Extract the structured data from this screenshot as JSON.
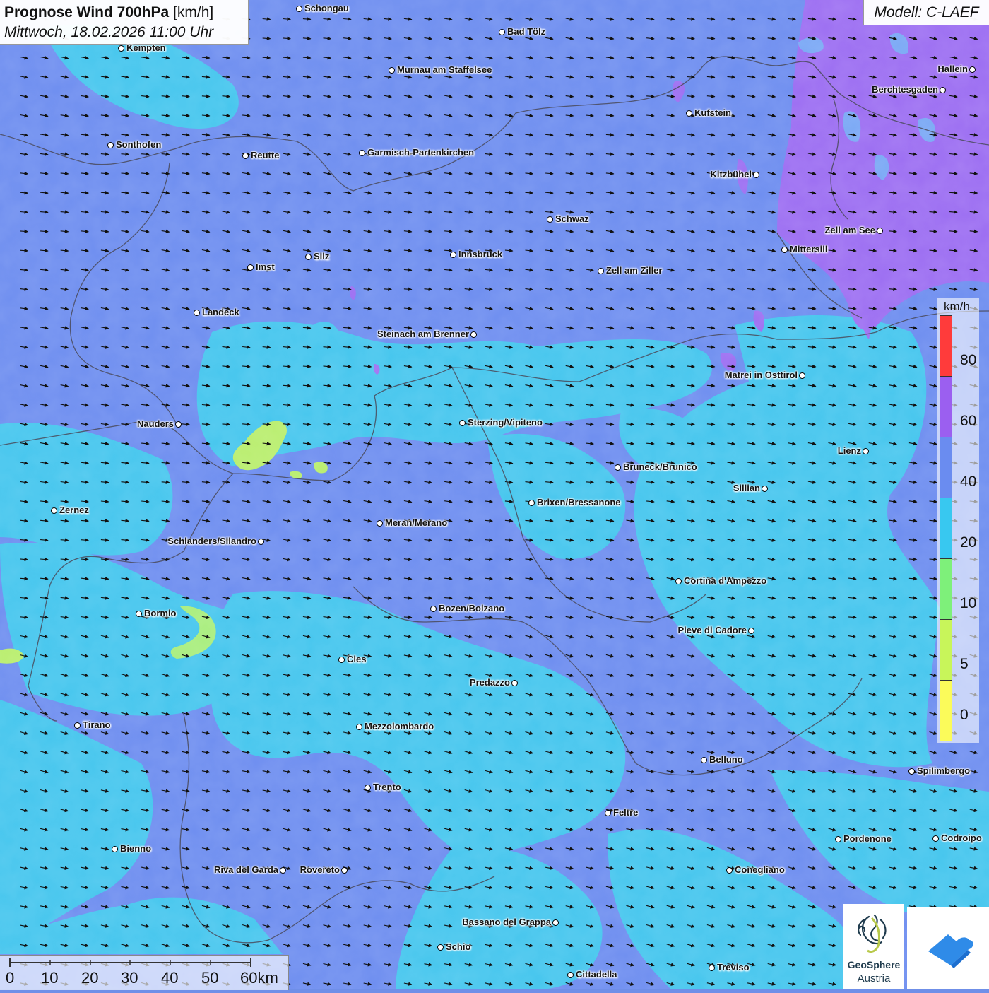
{
  "title": {
    "bold": "Prognose Wind 700hPa",
    "unit": "[km/h]",
    "datetime": "Mittwoch, 18.02.2026 11:00 Uhr"
  },
  "model": "Modell: C-LAEF",
  "legend": {
    "unit": "km/h",
    "ticks": [
      "80",
      "60",
      "40",
      "20",
      "10",
      "5",
      "0"
    ],
    "colors": [
      "#ff3b3b",
      "#9b5ff0",
      "#6a8cf0",
      "#38c8f0",
      "#7ef07a",
      "#c8f55a",
      "#fbfb5a"
    ]
  },
  "wind": {
    "direction": "west-northwest flow",
    "range_kmh": "20-80"
  },
  "cities": [
    {
      "name": "Schongau"
    },
    {
      "name": "Bad Tölz"
    },
    {
      "name": "Kempten"
    },
    {
      "name": "Murnau am Staffelsee"
    },
    {
      "name": "Hallein"
    },
    {
      "name": "Berchtesgaden"
    },
    {
      "name": "Kufstein"
    },
    {
      "name": "Sonthofen"
    },
    {
      "name": "Reutte"
    },
    {
      "name": "Garmisch-Partenkirchen"
    },
    {
      "name": "Kitzbühel"
    },
    {
      "name": "Schwaz"
    },
    {
      "name": "Zell am See"
    },
    {
      "name": "Mittersill"
    },
    {
      "name": "Innsbruck"
    },
    {
      "name": "Silz"
    },
    {
      "name": "Imst"
    },
    {
      "name": "Zell am Ziller"
    },
    {
      "name": "Landeck"
    },
    {
      "name": "Steinach am Brenner"
    },
    {
      "name": "Matrei in Osttirol"
    },
    {
      "name": "Nauders"
    },
    {
      "name": "Sterzing/Vipiteno"
    },
    {
      "name": "Lienz"
    },
    {
      "name": "Bruneck/Brunico"
    },
    {
      "name": "Sillian"
    },
    {
      "name": "Brixen/Bressanone"
    },
    {
      "name": "Zernez"
    },
    {
      "name": "Meran/Merano"
    },
    {
      "name": "Schlanders/Silandro"
    },
    {
      "name": "Cortina d'Ampezzo"
    },
    {
      "name": "Bozen/Bolzano"
    },
    {
      "name": "Bormio"
    },
    {
      "name": "Pieve di Cadore"
    },
    {
      "name": "Cles"
    },
    {
      "name": "Predazzo"
    },
    {
      "name": "Tirano"
    },
    {
      "name": "Mezzolombardo"
    },
    {
      "name": "Belluno"
    },
    {
      "name": "Spilimbergo"
    },
    {
      "name": "Trento"
    },
    {
      "name": "Feltre"
    },
    {
      "name": "Pordenone"
    },
    {
      "name": "Codroipo"
    },
    {
      "name": "Bienno"
    },
    {
      "name": "Riva del Garda"
    },
    {
      "name": "Rovereto"
    },
    {
      "name": "Conegliano"
    },
    {
      "name": "Bassano del Grappa"
    },
    {
      "name": "Schio"
    },
    {
      "name": "Treviso"
    },
    {
      "name": "Cittadella"
    }
  ],
  "scale": {
    "labels": [
      "0",
      "10",
      "20",
      "30",
      "40",
      "50",
      "60km"
    ]
  },
  "logo": {
    "name1": "GeoSphere",
    "name2": "Austria"
  }
}
